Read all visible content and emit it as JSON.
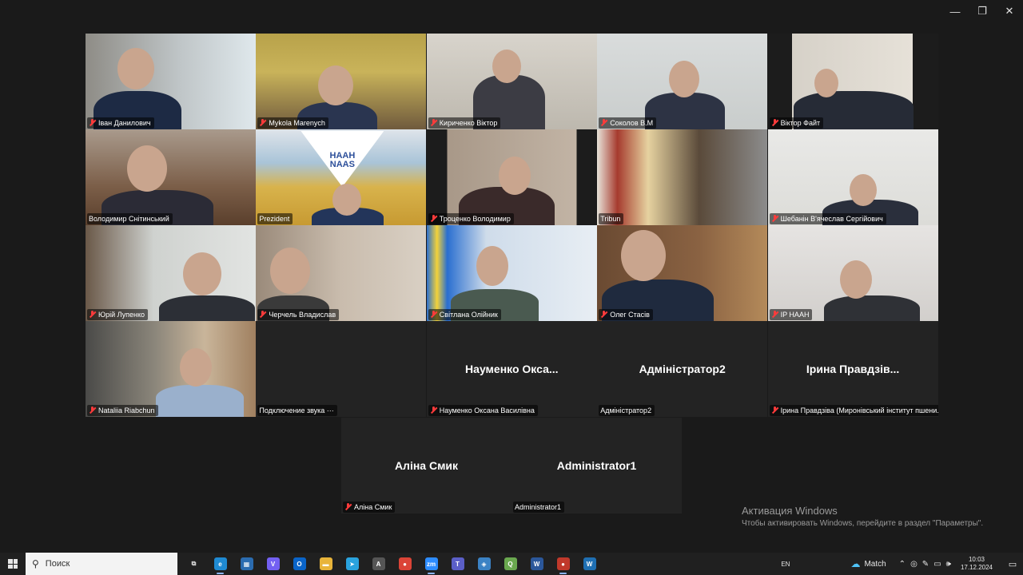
{
  "window": {
    "minimize": "—",
    "restore": "❐",
    "close": "✕"
  },
  "tiles": [
    {
      "name": "Іван Данилович",
      "muted": true
    },
    {
      "name": "Mykola Marenych",
      "muted": true
    },
    {
      "name": "Кириченко Віктор",
      "muted": true
    },
    {
      "name": "Соколов В.М",
      "muted": true
    },
    {
      "name": "Віктор Файт",
      "muted": true
    },
    {
      "name": "Володимир Снітинський",
      "muted": false
    },
    {
      "name": "Prezident",
      "muted": false
    },
    {
      "name": "Троценко Володимир",
      "muted": true
    },
    {
      "name": "Tribun",
      "muted": false
    },
    {
      "name": "Шебанін В'ячеслав Сергійович",
      "muted": true
    },
    {
      "name": "Юрій Лупенко",
      "muted": true
    },
    {
      "name": "Черчель Владислав",
      "muted": true
    },
    {
      "name": "Світлана Олійник",
      "muted": true
    },
    {
      "name": "Олег Стасів",
      "muted": true
    },
    {
      "name": "IP НААН",
      "muted": true
    },
    {
      "name": "Nataliia Riabchun",
      "muted": true
    },
    {
      "name": "Подключение звука ···",
      "muted": false,
      "center": ""
    },
    {
      "name": "Науменко Оксана Василівна",
      "muted": true,
      "center": "Науменко Окса..."
    },
    {
      "name": "Адміністратор2",
      "muted": false,
      "center": "Адміністратор2",
      "active": true
    },
    {
      "name": "Ірина Правдзіва (Миронівський інститут пшени...",
      "muted": true,
      "center": "Ірина Правдзів..."
    }
  ],
  "bottom_tiles": [
    {
      "name": "Аліна Смик",
      "muted": true,
      "center": "Аліна Смик"
    },
    {
      "name": "Administrator1",
      "muted": false,
      "center": "Administrator1"
    }
  ],
  "naas_logo": {
    "line1": "НААН",
    "line2": "NAAS"
  },
  "activation": {
    "title": "Активация Windows",
    "subtitle": "Чтобы активировать Windows, перейдите в раздел \"Параметры\"."
  },
  "taskbar": {
    "search_placeholder": "Поиск",
    "apps": [
      {
        "icon": "task-view-icon",
        "label": "⧉",
        "color": "transparent"
      },
      {
        "icon": "edge-icon",
        "label": "e",
        "color": "#1f8ad2"
      },
      {
        "icon": "store-icon",
        "label": "▦",
        "color": "#2b6cb0"
      },
      {
        "icon": "viber-icon",
        "label": "V",
        "color": "#7360f2"
      },
      {
        "icon": "outlook-icon",
        "label": "O",
        "color": "#0a64c8"
      },
      {
        "icon": "explorer-icon",
        "label": "▬",
        "color": "#e8b43a"
      },
      {
        "icon": "telegram-icon",
        "label": "➤",
        "color": "#2aa3de"
      },
      {
        "icon": "font-icon",
        "label": "A",
        "color": "#555555"
      },
      {
        "icon": "chrome-icon",
        "label": "●",
        "color": "#db4437"
      },
      {
        "icon": "zoom-icon",
        "label": "zm",
        "color": "#2d8cff"
      },
      {
        "icon": "teams-icon",
        "label": "T",
        "color": "#5b5fc7"
      },
      {
        "icon": "network-icon",
        "label": "◈",
        "color": "#3b82c4"
      },
      {
        "icon": "qgis-icon",
        "label": "Q",
        "color": "#6aa84f"
      },
      {
        "icon": "word-icon",
        "label": "W",
        "color": "#2b579a"
      },
      {
        "icon": "chrome-alt-icon",
        "label": "●",
        "color": "#c0392b"
      },
      {
        "icon": "app-icon",
        "label": "W",
        "color": "#1f6fb2"
      }
    ],
    "language": "EN",
    "weather": "Match",
    "time": "10:03",
    "date": "17.12.2024"
  }
}
